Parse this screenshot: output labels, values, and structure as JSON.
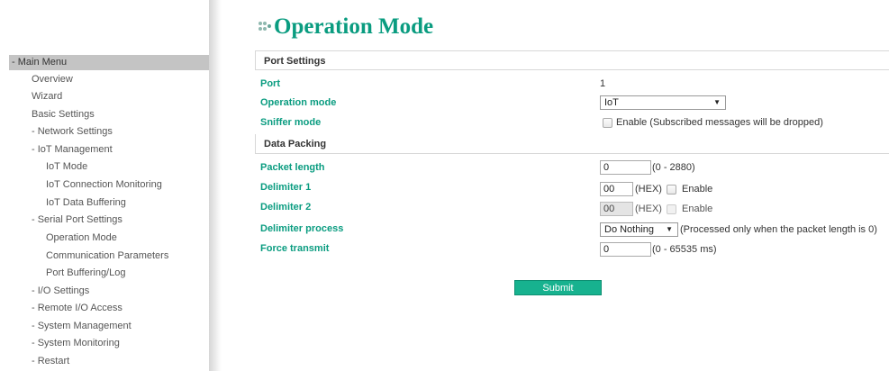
{
  "sidebar": {
    "header": "- Main Menu",
    "items": [
      {
        "label": "Overview"
      },
      {
        "label": "Wizard"
      },
      {
        "label": "Basic Settings"
      },
      {
        "label": "- Network Settings"
      },
      {
        "label": "- IoT Management"
      },
      {
        "label": "IoT Mode"
      },
      {
        "label": "IoT Connection Monitoring"
      },
      {
        "label": "IoT Data Buffering"
      },
      {
        "label": "- Serial Port Settings"
      },
      {
        "label": "Operation Mode"
      },
      {
        "label": "Communication Parameters"
      },
      {
        "label": "Port Buffering/Log"
      },
      {
        "label": "- I/O Settings"
      },
      {
        "label": "- Remote I/O Access"
      },
      {
        "label": "- System Management"
      },
      {
        "label": "- System Monitoring"
      },
      {
        "label": "- Restart"
      }
    ]
  },
  "page": {
    "title": "Operation Mode",
    "title_color": "#0a9c80"
  },
  "port_settings": {
    "header": "Port Settings",
    "port_label": "Port",
    "port_value": "1",
    "operation_mode_label": "Operation mode",
    "operation_mode_value": "IoT",
    "sniffer_mode_label": "Sniffer mode",
    "sniffer_mode_hint": "Enable (Subscribed messages will be dropped)",
    "sniffer_mode_checked": false
  },
  "data_packing": {
    "header": "Data Packing",
    "packet_length_label": "Packet length",
    "packet_length_value": "0",
    "packet_length_hint": "(0 - 2880)",
    "delimiter1_label": "Delimiter 1",
    "delimiter1_value": "00",
    "delimiter1_unit": "(HEX)",
    "delimiter1_enable": "Enable",
    "delimiter2_label": "Delimiter 2",
    "delimiter2_value": "00",
    "delimiter2_unit": "(HEX)",
    "delimiter2_enable": "Enable",
    "delimiter_process_label": "Delimiter process",
    "delimiter_process_value": "Do Nothing",
    "delimiter_process_hint": "(Processed only when the packet length is 0)",
    "force_transmit_label": "Force transmit",
    "force_transmit_value": "0",
    "force_transmit_hint": "(0 - 65535 ms)"
  },
  "actions": {
    "submit_label": "Submit",
    "submit_color": "#17b28f"
  },
  "icons": {
    "title_icon": "dots-icon",
    "select_arrow": "chevron-down-icon"
  }
}
